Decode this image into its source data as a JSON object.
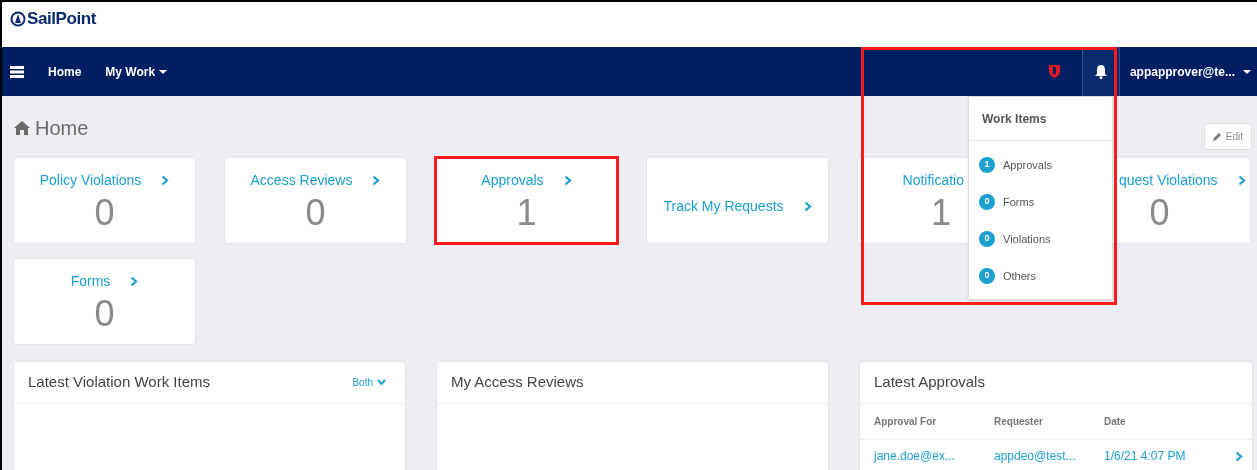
{
  "brand": {
    "name": "SailPoint"
  },
  "nav": {
    "items": [
      {
        "label": "Home",
        "has_caret": false
      },
      {
        "label": "My Work",
        "has_caret": true
      }
    ],
    "user": "appapprover@te...",
    "notifications": {
      "highlighted": true,
      "open": true
    }
  },
  "dropdown": {
    "title": "Work Items",
    "items": [
      {
        "count": "1",
        "label": "Approvals"
      },
      {
        "count": "0",
        "label": "Forms"
      },
      {
        "count": "0",
        "label": "Violations"
      },
      {
        "count": "0",
        "label": "Others"
      }
    ]
  },
  "page": {
    "title": "Home",
    "edit_button": "Edit"
  },
  "cards": [
    {
      "title": "Policy Violations",
      "value": "0",
      "highlighted": false
    },
    {
      "title": "Access Reviews",
      "value": "0",
      "highlighted": false
    },
    {
      "title": "Approvals",
      "value": "1",
      "highlighted": true
    },
    {
      "title": "Track My Requests",
      "highlighted": false
    },
    {
      "title": "Notificatio",
      "value": "1",
      "highlighted": false
    },
    {
      "title": "quest Violations",
      "value": "0",
      "highlighted": false
    },
    {
      "title": "Forms",
      "value": "0",
      "highlighted": false
    }
  ],
  "panels": [
    {
      "title": "Latest Violation Work Items",
      "filter": "Both"
    },
    {
      "title": "My Access Reviews"
    },
    {
      "title": "Latest Approvals",
      "table": {
        "columns": [
          "Approval For",
          "Requester",
          "Date"
        ],
        "rows": [
          [
            "jane.doe@ex...",
            "appdeo@test...",
            "1/6/21 4:07 PM"
          ]
        ]
      }
    }
  ]
}
